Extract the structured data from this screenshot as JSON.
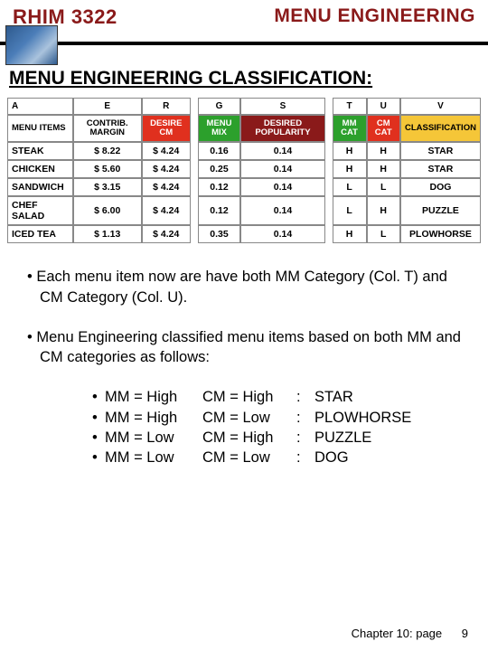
{
  "header": {
    "left": "RHIM 3322",
    "right": "MENU ENGINEERING"
  },
  "section_title": "MENU ENGINEERING CLASSIFICATION:",
  "table": {
    "letters": [
      "A",
      "E",
      "R",
      "G",
      "S",
      "T",
      "U",
      "V"
    ],
    "headers": [
      "MENU ITEMS",
      "CONTRIB. MARGIN",
      "DESIRE CM",
      "MENU MIX",
      "DESIRED POPULARITY",
      "MM CAT",
      "CM CAT",
      "CLASSIFICATION"
    ],
    "rows": [
      {
        "item": "STEAK",
        "cm": "$    8.22",
        "dcm": "$ 4.24",
        "mix": "0.16",
        "pop": "0.14",
        "mm": "H",
        "cmcat": "H",
        "cls": "STAR"
      },
      {
        "item": "CHICKEN",
        "cm": "$    5.60",
        "dcm": "$ 4.24",
        "mix": "0.25",
        "pop": "0.14",
        "mm": "H",
        "cmcat": "H",
        "cls": "STAR"
      },
      {
        "item": "SANDWICH",
        "cm": "$    3.15",
        "dcm": "$ 4.24",
        "mix": "0.12",
        "pop": "0.14",
        "mm": "L",
        "cmcat": "L",
        "cls": "DOG"
      },
      {
        "item": "CHEF SALAD",
        "cm": "$    6.00",
        "dcm": "$ 4.24",
        "mix": "0.12",
        "pop": "0.14",
        "mm": "L",
        "cmcat": "H",
        "cls": "PUZZLE"
      },
      {
        "item": "ICED TEA",
        "cm": "$    1.13",
        "dcm": "$ 4.24",
        "mix": "0.35",
        "pop": "0.14",
        "mm": "H",
        "cmcat": "L",
        "cls": "PLOWHORSE"
      }
    ]
  },
  "bullet1": "Each menu item now are have both MM Category (Col. T) and CM Category (Col. U).",
  "bullet2": "Menu Engineering classified menu items based on both MM and CM categories as follows:",
  "rules": [
    {
      "mm": "MM = High",
      "cm": "CM = High",
      "sep": ":",
      "cls": "STAR"
    },
    {
      "mm": "MM = High",
      "cm": "CM = Low",
      "sep": ":",
      "cls": "PLOWHORSE"
    },
    {
      "mm": "MM = Low",
      "cm": "CM = High",
      "sep": ":",
      "cls": "PUZZLE"
    },
    {
      "mm": "MM = Low",
      "cm": "CM = Low",
      "sep": ":",
      "cls": "DOG"
    }
  ],
  "footer": {
    "label": "Chapter 10: page",
    "num": "9"
  }
}
